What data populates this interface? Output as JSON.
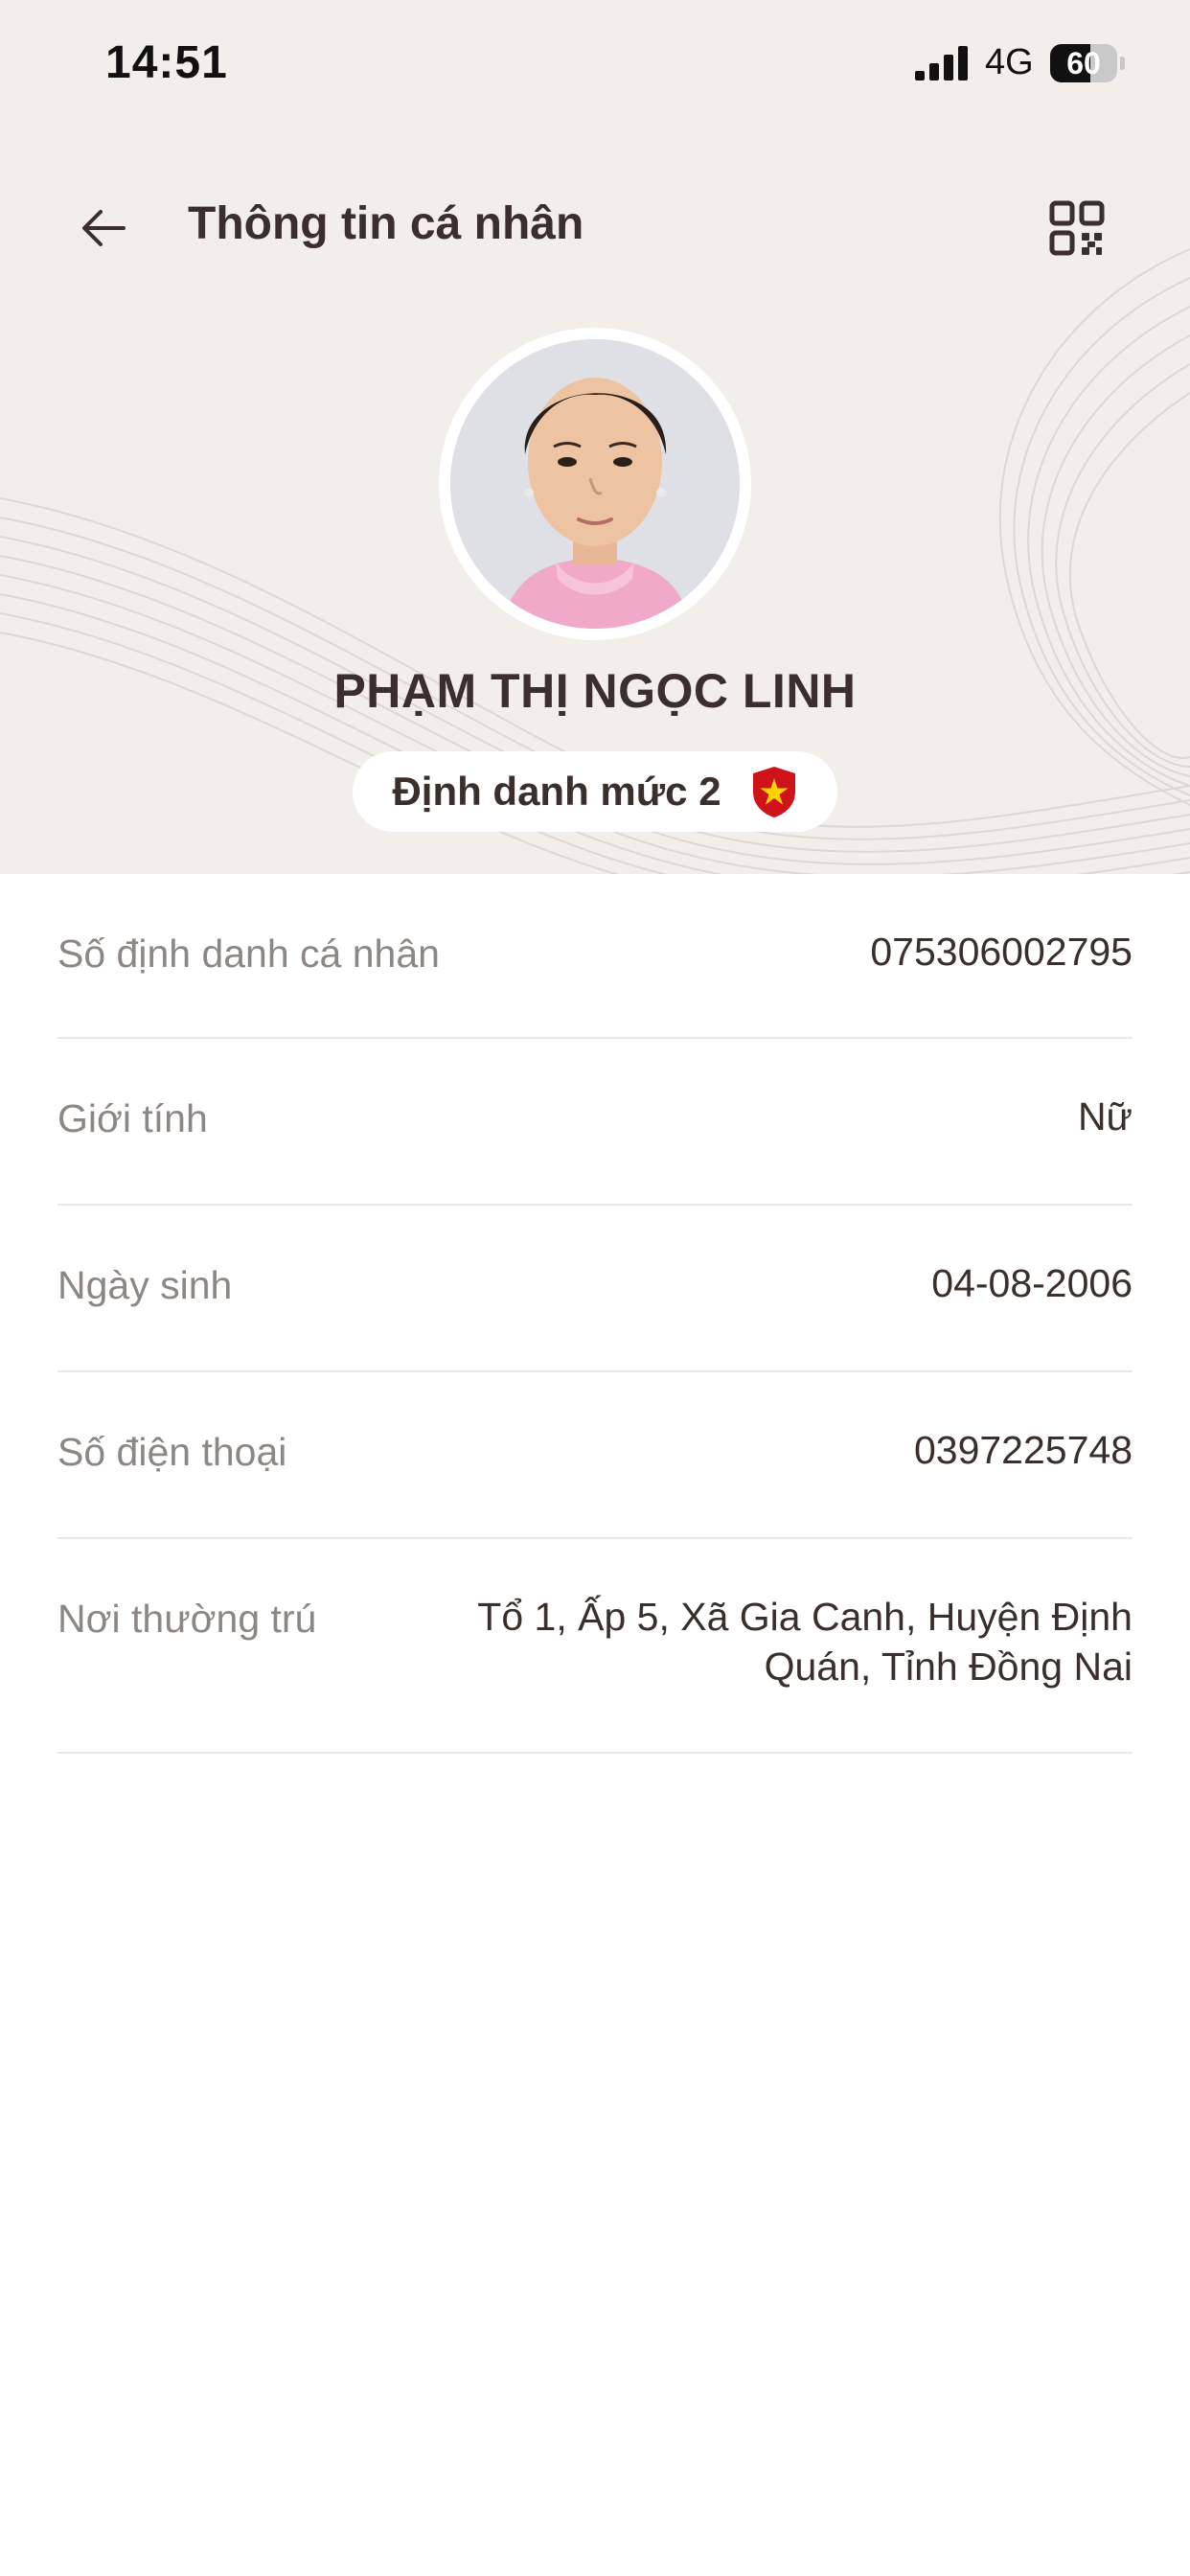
{
  "status_bar": {
    "time": "14:51",
    "network": "4G",
    "battery": "60",
    "battery_level": 0.6,
    "signal_icon": "cellular-signal-icon"
  },
  "header": {
    "title": "Thông tin cá nhân",
    "back_icon": "back-arrow-icon",
    "qr_icon": "qr-code-icon"
  },
  "profile": {
    "name": "PHẠM THỊ NGỌC LINH",
    "level_badge": "Định danh mức 2",
    "badge_icon": "shield-star-icon"
  },
  "info": [
    {
      "label": "Số định danh cá nhân",
      "value": "075306002795"
    },
    {
      "label": "Giới tính",
      "value": "Nữ"
    },
    {
      "label": "Ngày sinh",
      "value": "04-08-2006"
    },
    {
      "label": "Số điện thoại",
      "value": "0397225748"
    },
    {
      "label": "Nơi thường trú",
      "value": "Tổ 1, Ấp 5, Xã Gia Canh, Huyện Định Quán, Tỉnh Đồng Nai"
    }
  ],
  "colors": {
    "header_background": "#f2eee9",
    "title_text": "#3a2f2b",
    "label_text": "#8d8784",
    "badge_shield": "#d0121b",
    "badge_star": "#ffd400"
  }
}
